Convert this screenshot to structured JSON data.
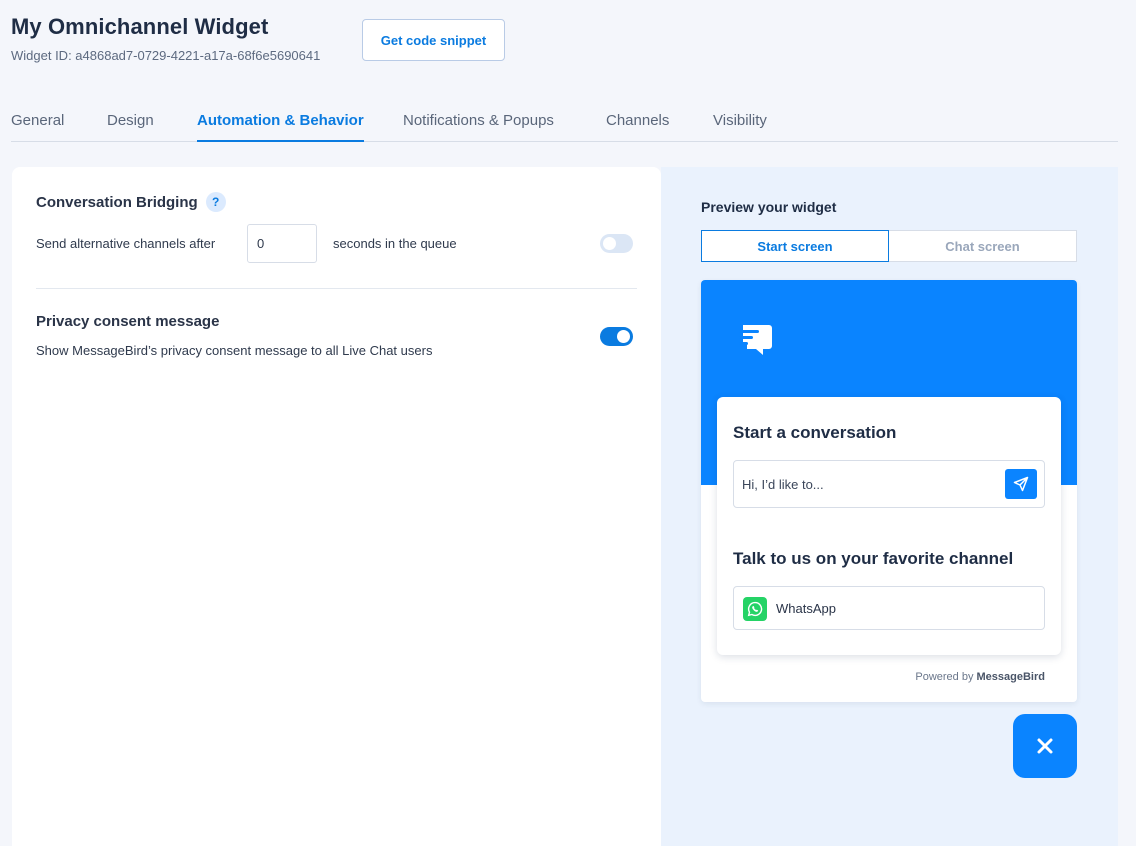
{
  "header": {
    "title": "My Omnichannel Widget",
    "widget_id": "Widget ID: a4868ad7-0729-4221-a17a-68f6e5690641",
    "snippet_button": "Get code snippet"
  },
  "tabs": [
    {
      "label": "General",
      "active": false
    },
    {
      "label": "Design",
      "active": false
    },
    {
      "label": "Automation & Behavior",
      "active": true
    },
    {
      "label": "Notifications & Popups",
      "active": false
    },
    {
      "label": "Channels",
      "active": false
    },
    {
      "label": "Visibility",
      "active": false
    }
  ],
  "settings": {
    "bridging": {
      "title": "Conversation Bridging",
      "help": "?",
      "label_before": "Send alternative channels after",
      "seconds_value": "0",
      "label_after": "seconds in the queue",
      "enabled": false
    },
    "privacy": {
      "title": "Privacy consent message",
      "description": "Show MessageBird’s privacy consent message to all Live Chat users",
      "enabled": true
    }
  },
  "preview": {
    "title": "Preview your widget",
    "tabs": [
      "Start screen",
      "Chat screen"
    ],
    "card_title": "Start a conversation",
    "message_placeholder": "Hi, I’d like to...",
    "favorite_title": "Talk to us on your favorite channel",
    "channel_label": "WhatsApp",
    "powered_by_prefix": "Powered by",
    "powered_by_brand": "MessageBird"
  },
  "colors": {
    "accent": "#0a7be0",
    "widget_blue": "#0a84ff",
    "whatsapp_green": "#25d366"
  }
}
